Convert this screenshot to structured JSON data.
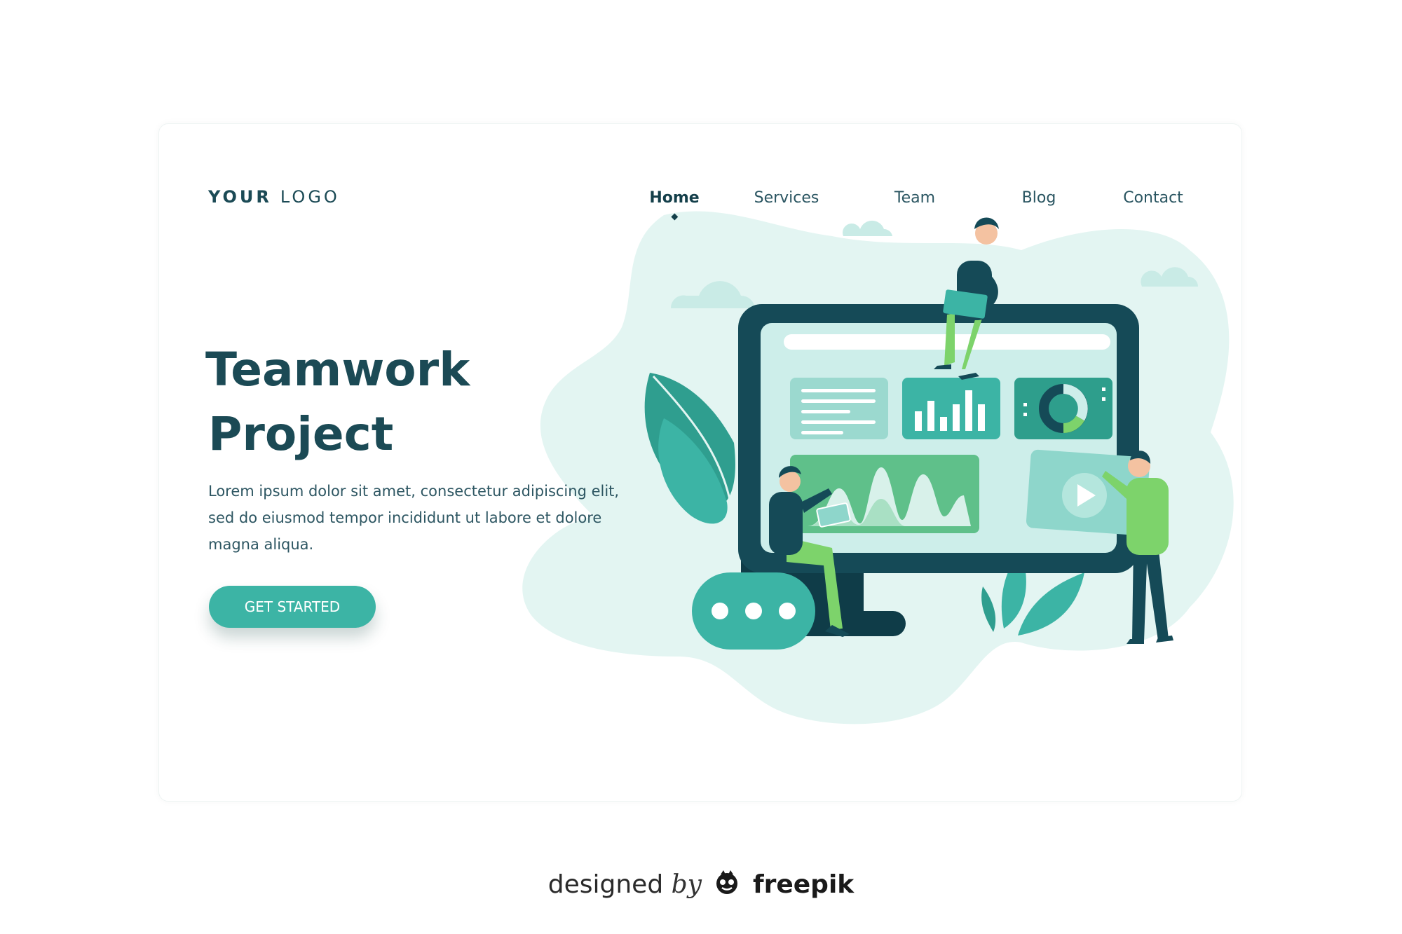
{
  "logo": {
    "bold": "YOUR",
    "light": "LOGO"
  },
  "nav": {
    "items": [
      {
        "label": "Home",
        "active": true
      },
      {
        "label": "Services",
        "active": false
      },
      {
        "label": "Team",
        "active": false
      },
      {
        "label": "Blog",
        "active": false
      },
      {
        "label": "Contact",
        "active": false
      }
    ]
  },
  "hero": {
    "title_line1": "Teamwork",
    "title_line2": "Project",
    "description": "Lorem ipsum dolor sit amet, consectetur adipiscing elit, sed do eiusmod tempor incididunt ut labore et dolore magna aliqua.",
    "cta_label": "GET STARTED"
  },
  "illustration": {
    "icons": [
      "cloud-icon",
      "monitor-icon",
      "bar-chart-icon",
      "donut-chart-icon",
      "play-icon",
      "chat-bubble-icon",
      "leaf-icon"
    ],
    "colors": {
      "accent": "#3cb4a5",
      "dark": "#1b4a55",
      "light_teal": "#e3f5f2",
      "green": "#7dd36b"
    }
  },
  "credit": {
    "designed": "designed",
    "by": "by",
    "brand": "freepik"
  }
}
